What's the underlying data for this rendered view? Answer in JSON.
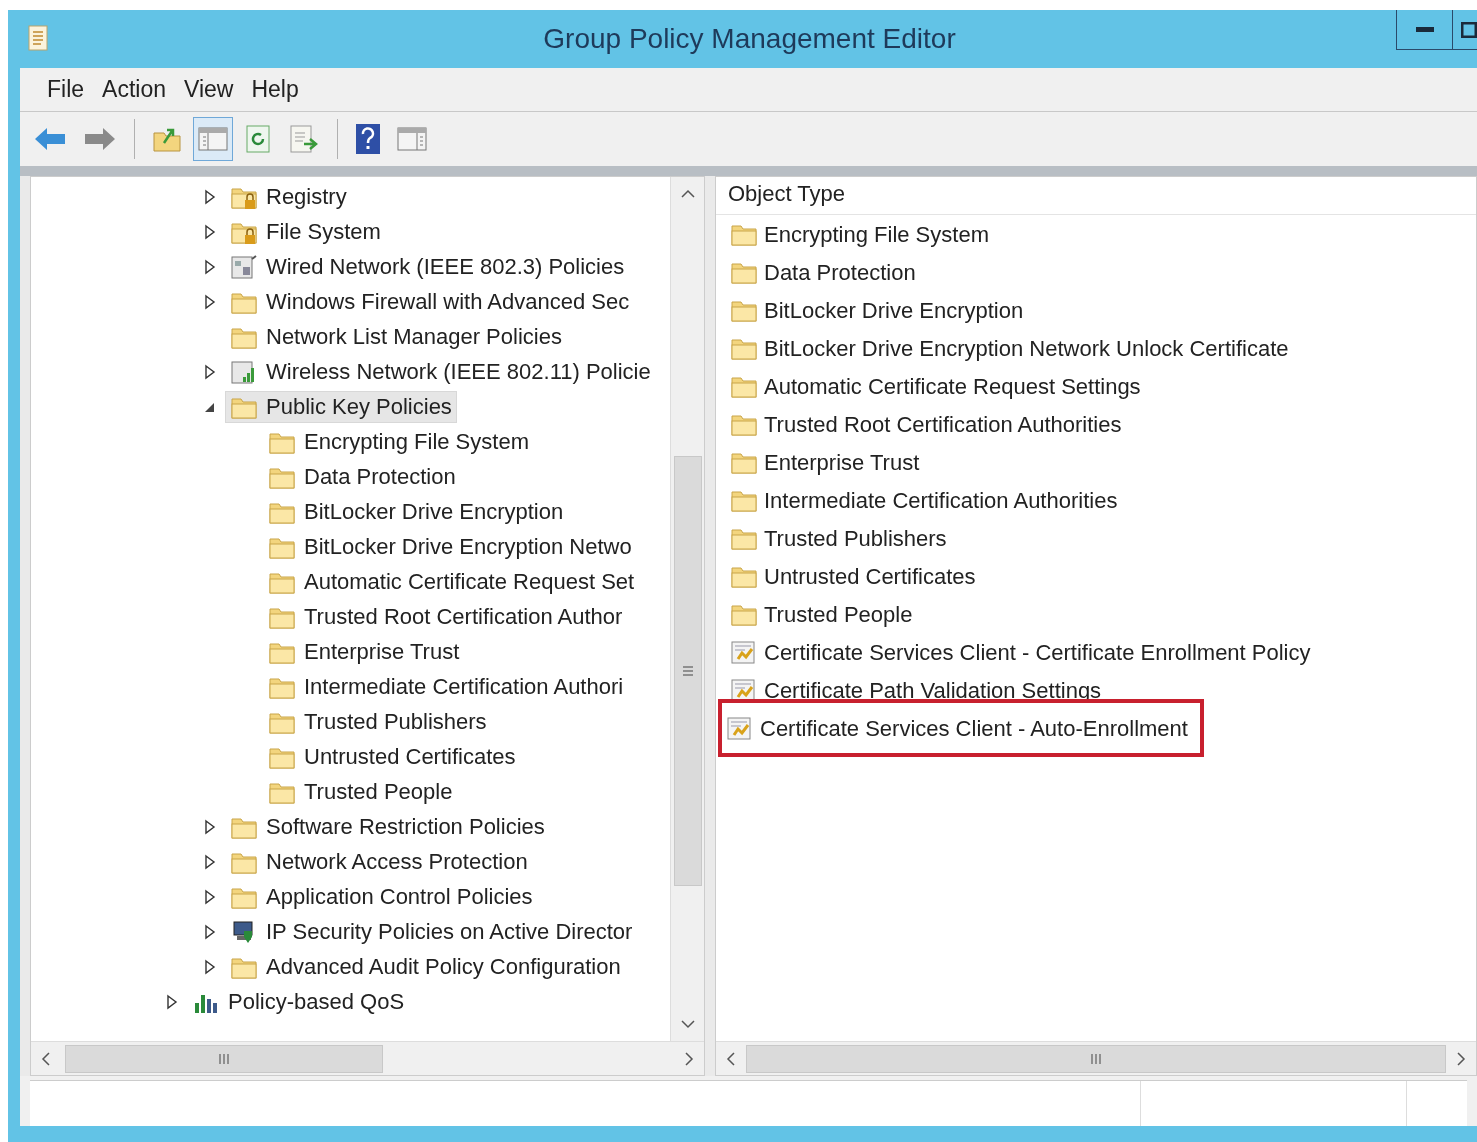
{
  "window": {
    "title": "Group Policy Management Editor"
  },
  "menu": [
    "File",
    "Action",
    "View",
    "Help"
  ],
  "toolbar": [
    {
      "kind": "back",
      "pressed": false
    },
    {
      "kind": "forward",
      "pressed": false
    },
    {
      "kind": "separator"
    },
    {
      "kind": "up",
      "pressed": false
    },
    {
      "kind": "console-tree",
      "pressed": true
    },
    {
      "kind": "refresh",
      "pressed": false
    },
    {
      "kind": "export",
      "pressed": false
    },
    {
      "kind": "separator"
    },
    {
      "kind": "help",
      "pressed": false
    },
    {
      "kind": "action-pane",
      "pressed": false
    }
  ],
  "tree": [
    {
      "children": [
        {
          "label": "Registry",
          "kind": "lock-folder",
          "expanded": false,
          "selected": false
        },
        {
          "label": "File System",
          "kind": "lock-folder",
          "expanded": false,
          "selected": false
        },
        {
          "label": "Wired Network (IEEE 802.3) Policies",
          "kind": "network",
          "expanded": false,
          "selected": false
        },
        {
          "label": "Windows Firewall with Advanced Sec",
          "kind": "folder",
          "expanded": false,
          "selected": false
        },
        {
          "label": "Network List Manager Policies",
          "kind": "folder",
          "selected": false
        },
        {
          "label": "Wireless Network (IEEE 802.11) Policie",
          "kind": "wireless",
          "expanded": false,
          "selected": false
        },
        {
          "label": "Public Key Policies",
          "kind": "folder",
          "expanded": true,
          "selected": true,
          "children": [
            {
              "label": "Encrypting File System",
              "kind": "folder",
              "selected": false
            },
            {
              "label": "Data Protection",
              "kind": "folder",
              "selected": false
            },
            {
              "label": "BitLocker Drive Encryption",
              "kind": "folder",
              "selected": false
            },
            {
              "label": "BitLocker Drive Encryption Netwo",
              "kind": "folder",
              "selected": false
            },
            {
              "label": "Automatic Certificate Request Set",
              "kind": "folder",
              "selected": false
            },
            {
              "label": "Trusted Root Certification Author",
              "kind": "folder",
              "selected": false
            },
            {
              "label": "Enterprise Trust",
              "kind": "folder",
              "selected": false
            },
            {
              "label": "Intermediate Certification Authori",
              "kind": "folder",
              "selected": false
            },
            {
              "label": "Trusted Publishers",
              "kind": "folder",
              "selected": false
            },
            {
              "label": "Untrusted Certificates",
              "kind": "folder",
              "selected": false
            },
            {
              "label": "Trusted People",
              "kind": "folder",
              "selected": false
            }
          ]
        },
        {
          "label": "Software Restriction Policies",
          "kind": "folder",
          "expanded": false,
          "selected": false
        },
        {
          "label": "Network Access Protection",
          "kind": "folder",
          "expanded": false,
          "selected": false
        },
        {
          "label": "Application Control Policies",
          "kind": "folder",
          "expanded": false,
          "selected": false
        },
        {
          "label": "IP Security Policies on Active Director",
          "kind": "computer",
          "expanded": false,
          "selected": false
        },
        {
          "label": "Advanced Audit Policy Configuration",
          "kind": "folder",
          "expanded": false,
          "selected": false
        }
      ]
    },
    {
      "label": "Policy-based QoS",
      "kind": "chart",
      "expanded": false,
      "selected": false
    }
  ],
  "list": {
    "columns": [
      "Object Type"
    ],
    "rows": [
      {
        "label": "Encrypting File System",
        "kind": "folder",
        "highlighted": false
      },
      {
        "label": "Data Protection",
        "kind": "folder",
        "highlighted": false
      },
      {
        "label": "BitLocker Drive Encryption",
        "kind": "folder",
        "highlighted": false
      },
      {
        "label": "BitLocker Drive Encryption Network Unlock Certificate",
        "kind": "folder",
        "highlighted": false
      },
      {
        "label": "Automatic Certificate Request Settings",
        "kind": "folder",
        "highlighted": false
      },
      {
        "label": "Trusted Root Certification Authorities",
        "kind": "folder",
        "highlighted": false
      },
      {
        "label": "Enterprise Trust",
        "kind": "folder",
        "highlighted": false
      },
      {
        "label": "Intermediate Certification Authorities",
        "kind": "folder",
        "highlighted": false
      },
      {
        "label": "Trusted Publishers",
        "kind": "folder",
        "highlighted": false
      },
      {
        "label": "Untrusted Certificates",
        "kind": "folder",
        "highlighted": false
      },
      {
        "label": "Trusted People",
        "kind": "folder",
        "highlighted": false
      },
      {
        "label": "Certificate Services Client - Certificate Enrollment Policy",
        "kind": "setting",
        "highlighted": false
      },
      {
        "label": "Certificate Path Validation Settings",
        "kind": "setting",
        "highlighted": false
      },
      {
        "label": "Certificate Services Client - Auto-Enrollment",
        "kind": "setting",
        "highlighted": true
      }
    ]
  }
}
